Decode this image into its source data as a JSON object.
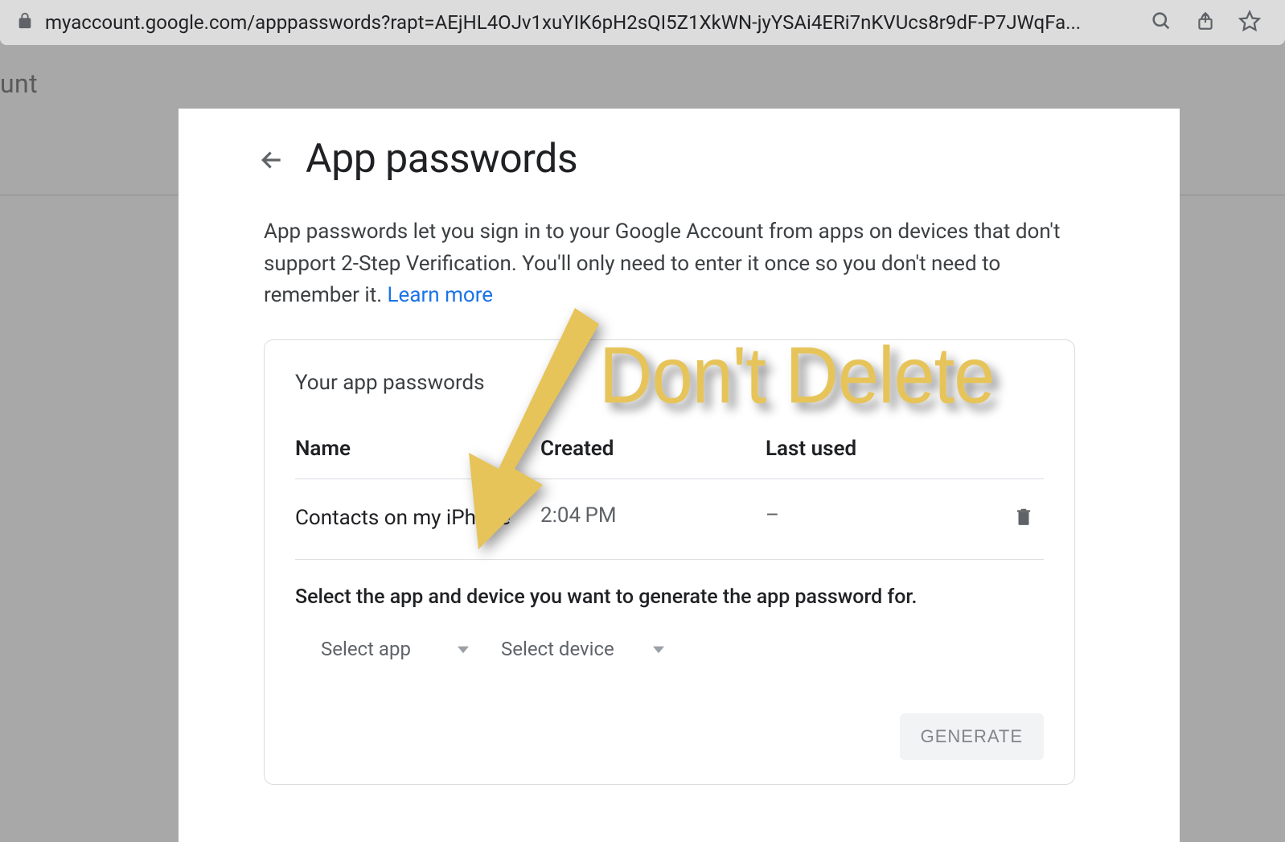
{
  "browser": {
    "url": "myaccount.google.com/apppasswords?rapt=AEjHL4OJv1xuYIK6pH2sQI5Z1XkWN-jyYSAi4ERi7nKVUcs8r9dF-P7JWqFa..."
  },
  "background": {
    "partial_text": "unt"
  },
  "page": {
    "title": "App passwords",
    "description_prefix": "App passwords let you sign in to your Google Account from apps on devices that don't support 2-Step Verification. You'll only need to enter it once so you don't need to remember it. ",
    "learn_more": "Learn more"
  },
  "card": {
    "title": "Your app passwords",
    "headers": {
      "name": "Name",
      "created": "Created",
      "last_used": "Last used"
    },
    "rows": [
      {
        "name": "Contacts on my iPhone",
        "created": "2:04 PM",
        "last_used": "–"
      }
    ],
    "select_prompt": "Select the app and device you want to generate the app password for.",
    "select_app": "Select app",
    "select_device": "Select device",
    "generate": "GENERATE"
  },
  "annotation": {
    "text": "Don't Delete"
  }
}
